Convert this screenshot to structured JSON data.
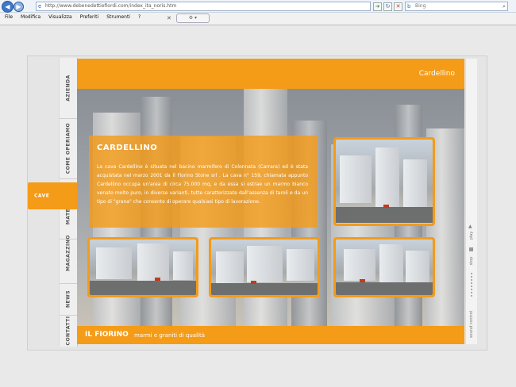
{
  "browser": {
    "url": "http://www.debenedettiefiordi.com/index_ita_noris.htm",
    "search_placeholder": "Bing",
    "menu": [
      "File",
      "Modifica",
      "Visualizza",
      "Preferiti",
      "Strumenti",
      "?"
    ]
  },
  "site": {
    "side_tabs": [
      "AZIENDA",
      "COME OPERIAMO",
      "MATERIALI",
      "CAVE",
      "MAGAZZINO",
      "NEWS",
      "CONTATTI"
    ],
    "active_tab": "CAVE",
    "header_title": "Cardellino",
    "quarry": {
      "title": "CARDELLINO",
      "description": "La cava Cardellino è situata nel bacino marmifero di Colonnata (Carrara) ed è stata acquistata nel marzo 2001 da Il Fiorino Stone srl . La cava n° 159, chiamata appunto Cardellino occupa un'area di circa 75.000 mq, e da essa si estrae un marmo bianco venato molto puro, in diverse varianti, tutte caratterizzate dall'assenza di taroli e da un tipo di \"grana\" che consente di operare qualsiasi tipo di lavorazione."
    },
    "footer": {
      "brand": "IL FIORINO",
      "tagline": "marmi e graniti di qualità"
    },
    "sound_panel": {
      "play": "play",
      "stop": "stop",
      "label": "sound control"
    }
  },
  "colors": {
    "accent": "#f49b18"
  }
}
